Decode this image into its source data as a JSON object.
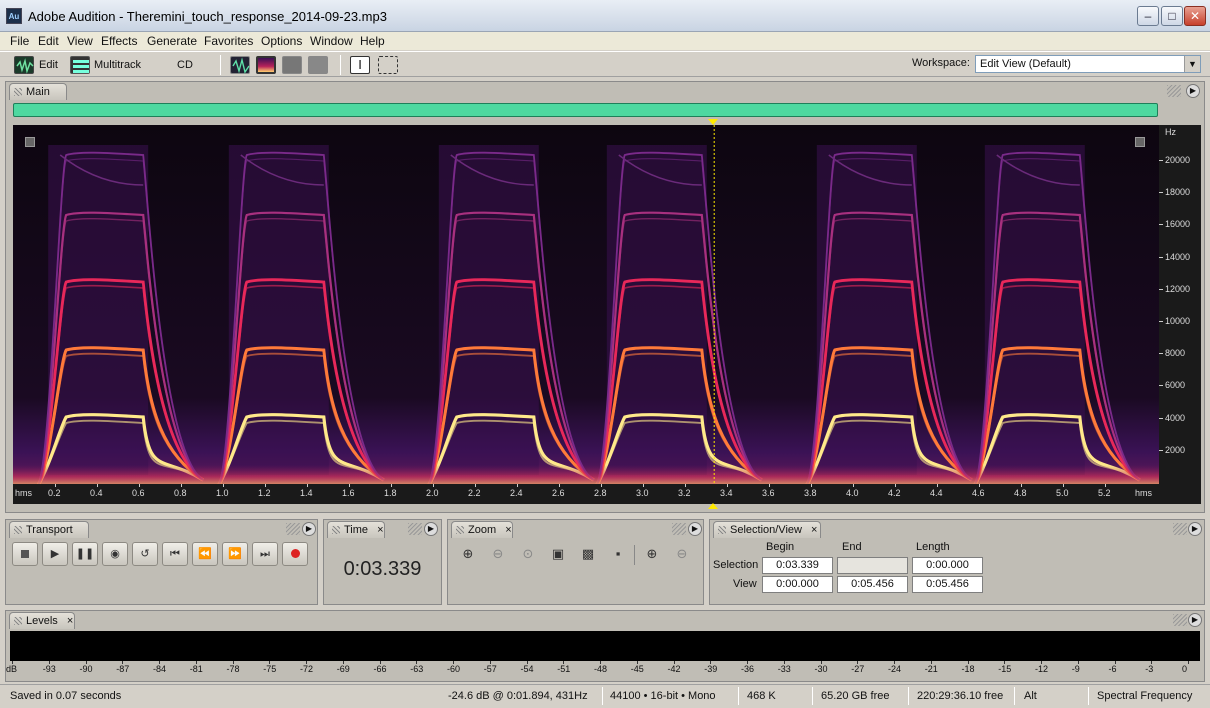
{
  "window": {
    "title": "Adobe Audition - Theremini_touch_response_2014-09-23.mp3",
    "app_icon_text": "Au",
    "minimize": "–",
    "maximize": "□",
    "close": "✕"
  },
  "menu": [
    "File",
    "Edit",
    "View",
    "Effects",
    "Generate",
    "Favorites",
    "Options",
    "Window",
    "Help"
  ],
  "toolbar": {
    "edit_label": "Edit",
    "multitrack_label": "Multitrack",
    "cd_label": "CD",
    "workspace_label": "Workspace:",
    "workspace_value": "Edit View (Default)"
  },
  "main_panel": {
    "tab_label": "Main"
  },
  "spectrogram": {
    "freq_unit": "Hz",
    "freq_ticks": [
      "20000",
      "18000",
      "16000",
      "14000",
      "12000",
      "10000",
      "8000",
      "6000",
      "4000",
      "2000"
    ],
    "time_unit_left": "hms",
    "time_unit_right": "hms",
    "time_ticks": [
      "0.2",
      "0.4",
      "0.6",
      "0.8",
      "1.0",
      "1.2",
      "1.4",
      "1.6",
      "1.8",
      "2.0",
      "2.2",
      "2.4",
      "2.6",
      "2.8",
      "3.0",
      "3.2",
      "3.4",
      "3.6",
      "3.8",
      "4.0",
      "4.2",
      "4.4",
      "4.6",
      "4.8",
      "5.0",
      "5.2"
    ],
    "cursor_time": 3.339,
    "duration": 5.456,
    "display": "Spectral Frequency"
  },
  "transport": {
    "tab_label": "Transport",
    "close": "×",
    "buttons": [
      "stop-icon",
      "play-icon",
      "pause-icon",
      "play-to-end-icon",
      "loop-icon",
      "go-to-start-icon",
      "rewind-icon",
      "fast-forward-icon",
      "go-to-end-icon",
      "record-icon"
    ]
  },
  "time_panel": {
    "tab_label": "Time",
    "close": "×",
    "value": "0:03.339"
  },
  "zoom": {
    "tab_label": "Zoom",
    "close": "×",
    "buttons": [
      "zoom-in-amplitude-icon",
      "zoom-out-amplitude-icon",
      "zoom-out-full-icon",
      "zoom-to-selection-icon",
      "zoom-left-edge-icon",
      "zoom-right-edge-icon",
      "zoom-in-time-icon",
      "zoom-out-time-icon"
    ]
  },
  "selection_view": {
    "tab_label": "Selection/View",
    "close": "×",
    "col_begin": "Begin",
    "col_end": "End",
    "col_length": "Length",
    "row_selection": "Selection",
    "row_view": "View",
    "selection_begin": "0:03.339",
    "selection_end": "",
    "selection_length": "0:00.000",
    "view_begin": "0:00.000",
    "view_end": "0:05.456",
    "view_length": "0:05.456"
  },
  "levels": {
    "tab_label": "Levels",
    "close": "×",
    "scale": [
      "dB",
      "-93",
      "-90",
      "-87",
      "-84",
      "-81",
      "-78",
      "-75",
      "-72",
      "-69",
      "-66",
      "-63",
      "-60",
      "-57",
      "-54",
      "-51",
      "-48",
      "-45",
      "-42",
      "-39",
      "-36",
      "-33",
      "-30",
      "-27",
      "-24",
      "-21",
      "-18",
      "-15",
      "-12",
      "-9",
      "-6",
      "-3",
      "0"
    ]
  },
  "status": {
    "message": "Saved in 0.07 seconds",
    "cursor_info": "-24.6 dB @  0:01.894, 431Hz",
    "format": "44100 • 16-bit • Mono",
    "file_size": "468 K",
    "disk_free": "65.20 GB free",
    "time_free": "220:29:36.10 free",
    "modifier": "Alt",
    "view_mode": "Spectral Frequency"
  },
  "colors": {
    "overview": "#4ed8a0",
    "spectro_bg": "#0e0712",
    "cursor": "#ffea00",
    "harmonic_hot": "#ffe98a",
    "harmonic_mid": "#ff3b5b",
    "harmonic_cool": "#8a2a8f"
  }
}
